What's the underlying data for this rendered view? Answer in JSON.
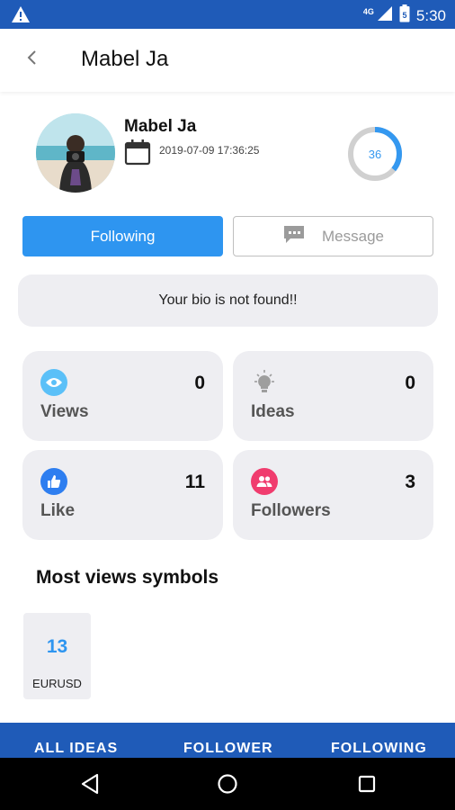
{
  "status_bar": {
    "time": "5:30",
    "network": "4G",
    "battery_level": "5",
    "icons": [
      "warning-icon",
      "signal-icon",
      "battery-icon"
    ]
  },
  "app_bar": {
    "title": "Mabel Ja",
    "back_icon": "chevron-left-icon"
  },
  "profile": {
    "name": "Mabel Ja",
    "date": "2019-07-09 17:36:25",
    "level": "36",
    "level_fraction": 0.36,
    "calendar_icon": "calendar-icon"
  },
  "actions": {
    "following_label": "Following",
    "message_label": "Message"
  },
  "bio": {
    "text": "Your bio is not found!!"
  },
  "stats": [
    {
      "label": "Views",
      "value": "0",
      "icon": "eye-icon",
      "color": "#5bc0f8"
    },
    {
      "label": "Ideas",
      "value": "0",
      "icon": "lightbulb-icon",
      "color": "#9e9e9e"
    },
    {
      "label": "Like",
      "value": "11",
      "icon": "thumbs-up-icon",
      "color": "#2e7ef0"
    },
    {
      "label": "Followers",
      "value": "3",
      "icon": "people-icon",
      "color": "#f03c6e"
    }
  ],
  "symbols_section": {
    "title": "Most views symbols",
    "items": [
      {
        "count": "13",
        "name": "EURUSD"
      }
    ]
  },
  "tabs": [
    {
      "label": "ALL IDEAS"
    },
    {
      "label": "FOLLOWER"
    },
    {
      "label": "FOLLOWING"
    }
  ],
  "colors": {
    "primary": "#1f5bb8",
    "accent": "#2e95f0",
    "card_bg": "#eeeef2"
  }
}
